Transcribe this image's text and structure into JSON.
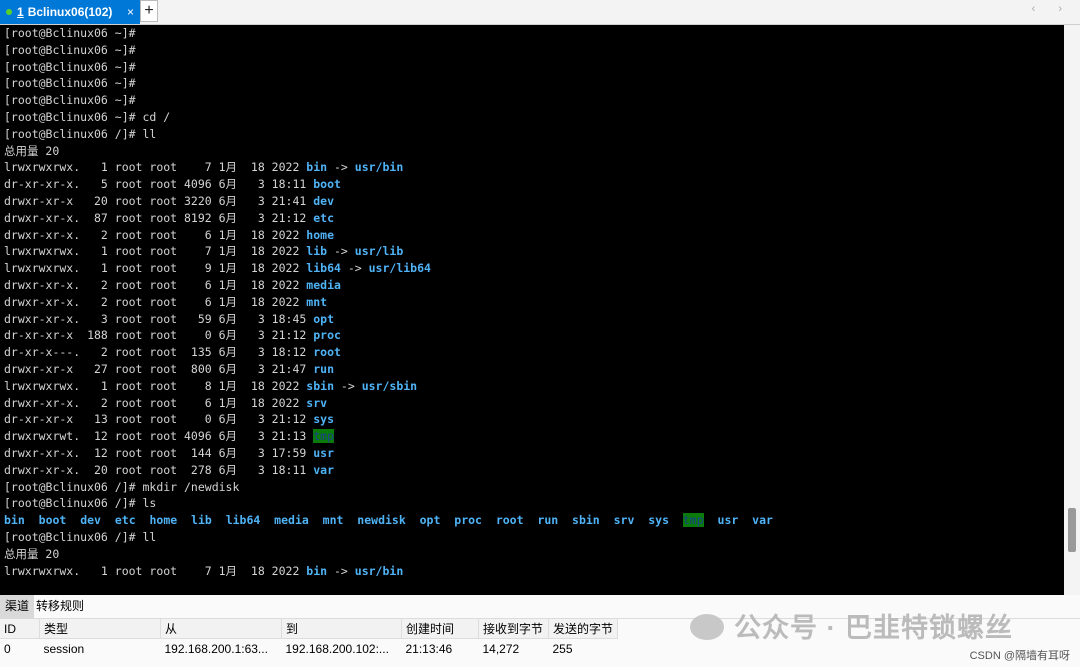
{
  "tab": {
    "number": "1",
    "title": "Bclinux06(102)",
    "close": "×",
    "add": "+",
    "nav": "‹ ›"
  },
  "terminal": {
    "lines": [
      [
        {
          "t": "[root@Bclinux06 ~]#"
        }
      ],
      [
        {
          "t": "[root@Bclinux06 ~]#"
        }
      ],
      [
        {
          "t": "[root@Bclinux06 ~]#"
        }
      ],
      [
        {
          "t": "[root@Bclinux06 ~]#"
        }
      ],
      [
        {
          "t": "[root@Bclinux06 ~]#"
        }
      ],
      [
        {
          "t": "[root@Bclinux06 ~]# cd /"
        }
      ],
      [
        {
          "t": "[root@Bclinux06 /]# ll"
        }
      ],
      [
        {
          "t": "总用量 20"
        }
      ],
      [
        {
          "t": "lrwxrwxrwx.   1 root root    7 1月  18 2022 "
        },
        {
          "t": "bin",
          "c": "c"
        },
        {
          "t": " -> "
        },
        {
          "t": "usr/bin",
          "c": "c"
        }
      ],
      [
        {
          "t": "dr-xr-xr-x.   5 root root 4096 6月   3 18:11 "
        },
        {
          "t": "boot",
          "c": "c"
        }
      ],
      [
        {
          "t": "drwxr-xr-x   20 root root 3220 6月   3 21:41 "
        },
        {
          "t": "dev",
          "c": "c"
        }
      ],
      [
        {
          "t": "drwxr-xr-x.  87 root root 8192 6月   3 21:12 "
        },
        {
          "t": "etc",
          "c": "c"
        }
      ],
      [
        {
          "t": "drwxr-xr-x.   2 root root    6 1月  18 2022 "
        },
        {
          "t": "home",
          "c": "c"
        }
      ],
      [
        {
          "t": "lrwxrwxrwx.   1 root root    7 1月  18 2022 "
        },
        {
          "t": "lib",
          "c": "c"
        },
        {
          "t": " -> "
        },
        {
          "t": "usr/lib",
          "c": "c"
        }
      ],
      [
        {
          "t": "lrwxrwxrwx.   1 root root    9 1月  18 2022 "
        },
        {
          "t": "lib64",
          "c": "c"
        },
        {
          "t": " -> "
        },
        {
          "t": "usr/lib64",
          "c": "c"
        }
      ],
      [
        {
          "t": "drwxr-xr-x.   2 root root    6 1月  18 2022 "
        },
        {
          "t": "media",
          "c": "c"
        }
      ],
      [
        {
          "t": "drwxr-xr-x.   2 root root    6 1月  18 2022 "
        },
        {
          "t": "mnt",
          "c": "c"
        }
      ],
      [
        {
          "t": "drwxr-xr-x.   3 root root   59 6月   3 18:45 "
        },
        {
          "t": "opt",
          "c": "c"
        }
      ],
      [
        {
          "t": "dr-xr-xr-x  188 root root    0 6月   3 21:12 "
        },
        {
          "t": "proc",
          "c": "c"
        }
      ],
      [
        {
          "t": "dr-xr-x---.   2 root root  135 6月   3 18:12 "
        },
        {
          "t": "root",
          "c": "c"
        }
      ],
      [
        {
          "t": "drwxr-xr-x   27 root root  800 6月   3 21:47 "
        },
        {
          "t": "run",
          "c": "c"
        }
      ],
      [
        {
          "t": "lrwxrwxrwx.   1 root root    8 1月  18 2022 "
        },
        {
          "t": "sbin",
          "c": "c"
        },
        {
          "t": " -> "
        },
        {
          "t": "usr/sbin",
          "c": "c"
        }
      ],
      [
        {
          "t": "drwxr-xr-x.   2 root root    6 1月  18 2022 "
        },
        {
          "t": "srv",
          "c": "c"
        }
      ],
      [
        {
          "t": "dr-xr-xr-x   13 root root    0 6月   3 21:12 "
        },
        {
          "t": "sys",
          "c": "c"
        }
      ],
      [
        {
          "t": "drwxrwxrwt.  12 root root 4096 6月   3 21:13 "
        },
        {
          "t": "tmp",
          "c": "g"
        }
      ],
      [
        {
          "t": "drwxr-xr-x.  12 root root  144 6月   3 17:59 "
        },
        {
          "t": "usr",
          "c": "c"
        }
      ],
      [
        {
          "t": "drwxr-xr-x.  20 root root  278 6月   3 18:11 "
        },
        {
          "t": "var",
          "c": "c"
        }
      ],
      [
        {
          "t": "[root@Bclinux06 /]# mkdir /newdisk"
        }
      ],
      [
        {
          "t": "[root@Bclinux06 /]# ls"
        }
      ],
      [
        {
          "t": "bin",
          "c": "c"
        },
        {
          "t": "  "
        },
        {
          "t": "boot",
          "c": "c"
        },
        {
          "t": "  "
        },
        {
          "t": "dev",
          "c": "c"
        },
        {
          "t": "  "
        },
        {
          "t": "etc",
          "c": "c"
        },
        {
          "t": "  "
        },
        {
          "t": "home",
          "c": "c"
        },
        {
          "t": "  "
        },
        {
          "t": "lib",
          "c": "c"
        },
        {
          "t": "  "
        },
        {
          "t": "lib64",
          "c": "c"
        },
        {
          "t": "  "
        },
        {
          "t": "media",
          "c": "c"
        },
        {
          "t": "  "
        },
        {
          "t": "mnt",
          "c": "c"
        },
        {
          "t": "  "
        },
        {
          "t": "newdisk",
          "c": "c"
        },
        {
          "t": "  "
        },
        {
          "t": "opt",
          "c": "c"
        },
        {
          "t": "  "
        },
        {
          "t": "proc",
          "c": "c"
        },
        {
          "t": "  "
        },
        {
          "t": "root",
          "c": "c"
        },
        {
          "t": "  "
        },
        {
          "t": "run",
          "c": "c"
        },
        {
          "t": "  "
        },
        {
          "t": "sbin",
          "c": "c"
        },
        {
          "t": "  "
        },
        {
          "t": "srv",
          "c": "c"
        },
        {
          "t": "  "
        },
        {
          "t": "sys",
          "c": "c"
        },
        {
          "t": "  "
        },
        {
          "t": "tmp",
          "c": "g"
        },
        {
          "t": "  "
        },
        {
          "t": "usr",
          "c": "c"
        },
        {
          "t": "  "
        },
        {
          "t": "var",
          "c": "c"
        }
      ],
      [
        {
          "t": "[root@Bclinux06 /]# ll"
        }
      ],
      [
        {
          "t": "总用量 20"
        }
      ],
      [
        {
          "t": "lrwxrwxrwx.   1 root root    7 1月  18 2022 "
        },
        {
          "t": "bin",
          "c": "c"
        },
        {
          "t": " -> "
        },
        {
          "t": "usr/bin",
          "c": "c"
        }
      ]
    ]
  },
  "panel": {
    "tabs": [
      "渠道",
      "转移规则"
    ],
    "columns": [
      "ID",
      "类型",
      "从",
      "到",
      "创建时间",
      "接收到字节",
      "发送的字节"
    ],
    "rows": [
      [
        "0",
        "session",
        "192.168.200.1:63...",
        "192.168.200.102:...",
        "21:13:46",
        "14,272",
        "255"
      ]
    ]
  },
  "watermark": "公众号 · 巴韭特锁螺丝",
  "credit": "CSDN @隔墙有耳呀"
}
